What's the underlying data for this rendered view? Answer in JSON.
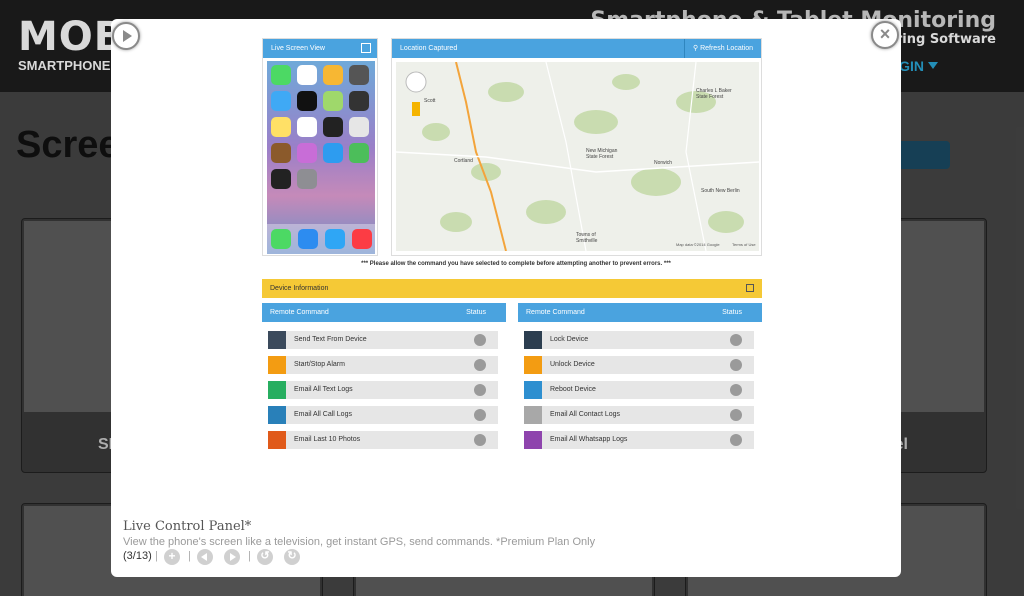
{
  "site": {
    "logo_text": "MOB",
    "logo_sub": "SMARTPHONE",
    "title": "Smartphone & Tablet Monitoring",
    "subtitle": "itoring Software",
    "login_label": "GIN",
    "heading": "Scree",
    "thumb_left_caption": "SN",
    "thumb_right_caption": "el"
  },
  "shot": {
    "live_screen_title": "Live Screen View",
    "location_title": "Location Captured",
    "refresh_label": "Refresh Location",
    "map_labels": [
      "Scott",
      "Charles L Baker State Forest",
      "Cortland",
      "New Michigan State Forest",
      "Norwich",
      "South New Berlin",
      "Towns of Smithville",
      "Map data ©2014 Google",
      "Terms of Use"
    ],
    "note": "*** Please allow the command you have selected to complete before attempting another to prevent errors. ***",
    "device_info_title": "Device Information",
    "left_panel": {
      "header": "Remote Command",
      "status": "Status",
      "commands": [
        {
          "label": "Send Text From Device",
          "color": "#3b4a5c"
        },
        {
          "label": "Start/Stop Alarm",
          "color": "#f39c12"
        },
        {
          "label": "Email All Text Logs",
          "color": "#27ae60"
        },
        {
          "label": "Email All Call Logs",
          "color": "#2980b9"
        },
        {
          "label": "Email Last 10 Photos",
          "color": "#e05a1a"
        }
      ]
    },
    "right_panel": {
      "header": "Remote Command",
      "status": "Status",
      "commands": [
        {
          "label": "Lock Device",
          "color": "#2c3e50"
        },
        {
          "label": "Unlock Device",
          "color": "#f39c12"
        },
        {
          "label": "Reboot Device",
          "color": "#2e8fd0"
        },
        {
          "label": "Email All Contact Logs",
          "color": "#a8a8a8"
        },
        {
          "label": "Email All Whatsapp Logs",
          "color": "#8e44ad"
        }
      ]
    }
  },
  "caption": {
    "title": "Live Control Panel*",
    "description": "View the phone's screen like a television, get instant GPS, send commands. *Premium Plan Only",
    "counter": "(3/13)"
  },
  "icons": {
    "play": "play-icon",
    "close": "close-icon",
    "zoom": "zoom-in-icon",
    "prev": "prev-icon",
    "next": "next-icon",
    "rotate_left": "rotate-left-icon",
    "rotate_right": "rotate-right-icon"
  }
}
